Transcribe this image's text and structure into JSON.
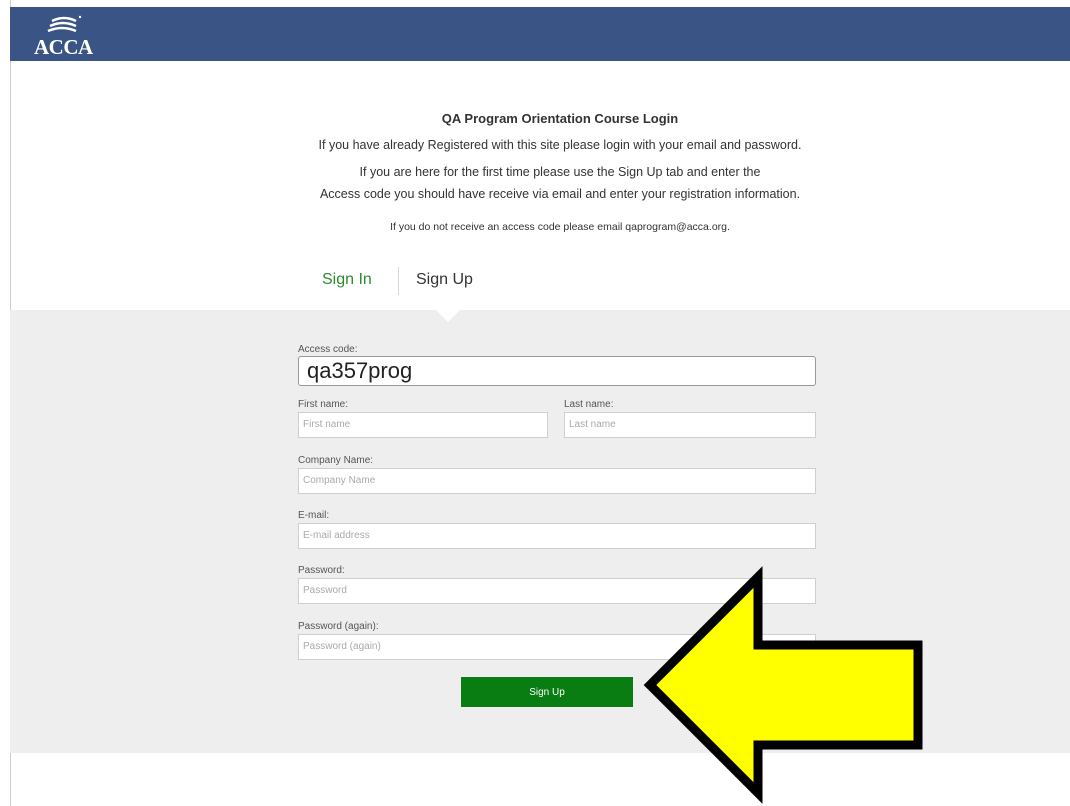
{
  "header": {
    "logo_text": "ACCA"
  },
  "intro": {
    "title": "QA Program Orientation Course Login",
    "line1": "If you have already Registered with this site please login with your email and password.",
    "line2": "If you are here for the first time please use the Sign Up tab and enter the",
    "line3": "Access code you should have receive via email and enter your registration information.",
    "line4": "If you do not receive an access code please email qaprogram@acca.org."
  },
  "tabs": {
    "sign_in": "Sign In",
    "sign_up": "Sign Up",
    "active": "Sign Up"
  },
  "form": {
    "access_code_label": "Access code:",
    "access_code_value": "qa357prog",
    "first_name_label": "First name:",
    "first_name_placeholder": "First name",
    "last_name_label": "Last name:",
    "last_name_placeholder": "Last name",
    "company_label": "Company Name:",
    "company_placeholder": "Company Name",
    "email_label": "E-mail:",
    "email_placeholder": "E-mail address",
    "password_label": "Password:",
    "password_placeholder": "Password",
    "password2_label": "Password (again):",
    "password2_placeholder": "Password (again)",
    "submit_label": "Sign Up"
  },
  "colors": {
    "header_bg": "#3a5486",
    "accent_green": "#2e8b2e",
    "button_green": "#0a7d12",
    "panel_bg": "#eeeeee",
    "arrow_fill": "#ffff00"
  },
  "annotation": {
    "icon": "arrow-left-icon"
  }
}
